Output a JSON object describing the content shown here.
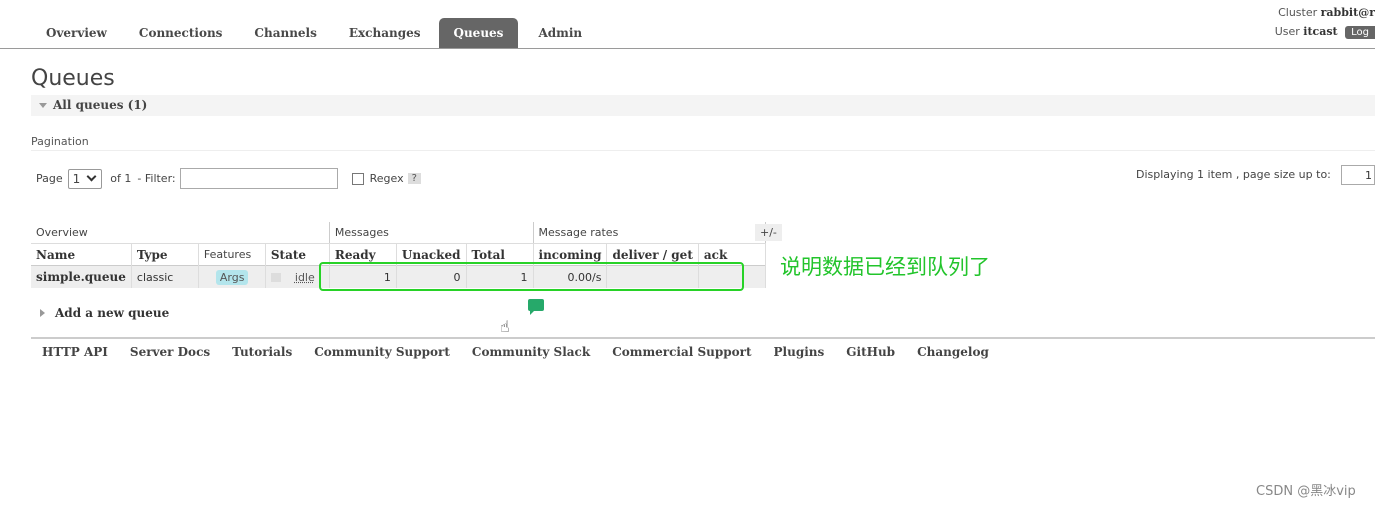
{
  "nav": {
    "tabs": [
      "Overview",
      "Connections",
      "Channels",
      "Exchanges",
      "Queues",
      "Admin"
    ],
    "active": "Queues"
  },
  "header": {
    "cluster_label": "Cluster",
    "cluster_name": "rabbit@r",
    "user_label": "User",
    "user_name": "itcast",
    "logout_label": "Log"
  },
  "page": {
    "title": "Queues",
    "section": "All queues (1)"
  },
  "pagination": {
    "label": "Pagination",
    "page_label": "Page",
    "page_value": "1",
    "of_text": "of 1",
    "filter_label": "- Filter:",
    "filter_value": "",
    "regex_label": "Regex",
    "help": "?",
    "display_text": "Displaying 1 item , page size up to:",
    "page_size": "1"
  },
  "table": {
    "groups": [
      "Overview",
      "Messages",
      "Message rates"
    ],
    "plus_minus": "+/-",
    "columns": [
      "Name",
      "Type",
      "Features",
      "State",
      "Ready",
      "Unacked",
      "Total",
      "incoming",
      "deliver / get",
      "ack"
    ],
    "rows": [
      {
        "name": "simple.queue",
        "type": "classic",
        "features": "Args",
        "state": "idle",
        "ready": "1",
        "unacked": "0",
        "total": "1",
        "incoming": "0.00/s",
        "deliver_get": "",
        "ack": ""
      }
    ]
  },
  "add_queue": "Add a new queue",
  "annotation": "说明数据已经到队列了",
  "footer": [
    "HTTP API",
    "Server Docs",
    "Tutorials",
    "Community Support",
    "Community Slack",
    "Commercial Support",
    "Plugins",
    "GitHub",
    "Changelog"
  ],
  "watermark": "CSDN @黑冰vip",
  "colors": {
    "tab_active": "#666666",
    "highlight": "#27d227",
    "annotation": "#22c42b",
    "args_tag": "#b3e5ec"
  }
}
